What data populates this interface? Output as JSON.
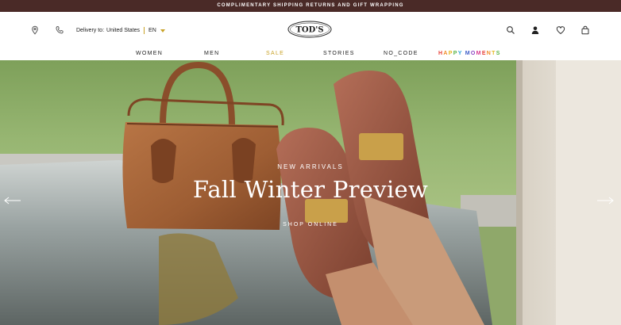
{
  "promo": {
    "text": "COMPLIMENTARY SHIPPING RETURNS AND GIFT WRAPPING"
  },
  "header": {
    "delivery_label": "Delivery to:",
    "delivery_country": "United States",
    "language": "EN",
    "logo_text": "TOD'S",
    "icons": [
      "location-pin-icon",
      "phone-icon",
      "search-icon",
      "user-icon",
      "heart-icon",
      "shopping-bag-icon"
    ]
  },
  "nav": {
    "items": [
      {
        "label": "WOMEN"
      },
      {
        "label": "MEN"
      },
      {
        "label": "SALE"
      },
      {
        "label": "STORIES"
      },
      {
        "label": "NO_CODE"
      },
      {
        "label": "HAPPY MOMENTS"
      }
    ]
  },
  "hero": {
    "eyebrow": "NEW ARRIVALS",
    "title": "Fall Winter Preview",
    "cta": "SHOP ONLINE"
  },
  "colors": {
    "promo_bg": "#4a2a27",
    "accent_gold": "#c9a227",
    "leather": "#a0603a"
  }
}
